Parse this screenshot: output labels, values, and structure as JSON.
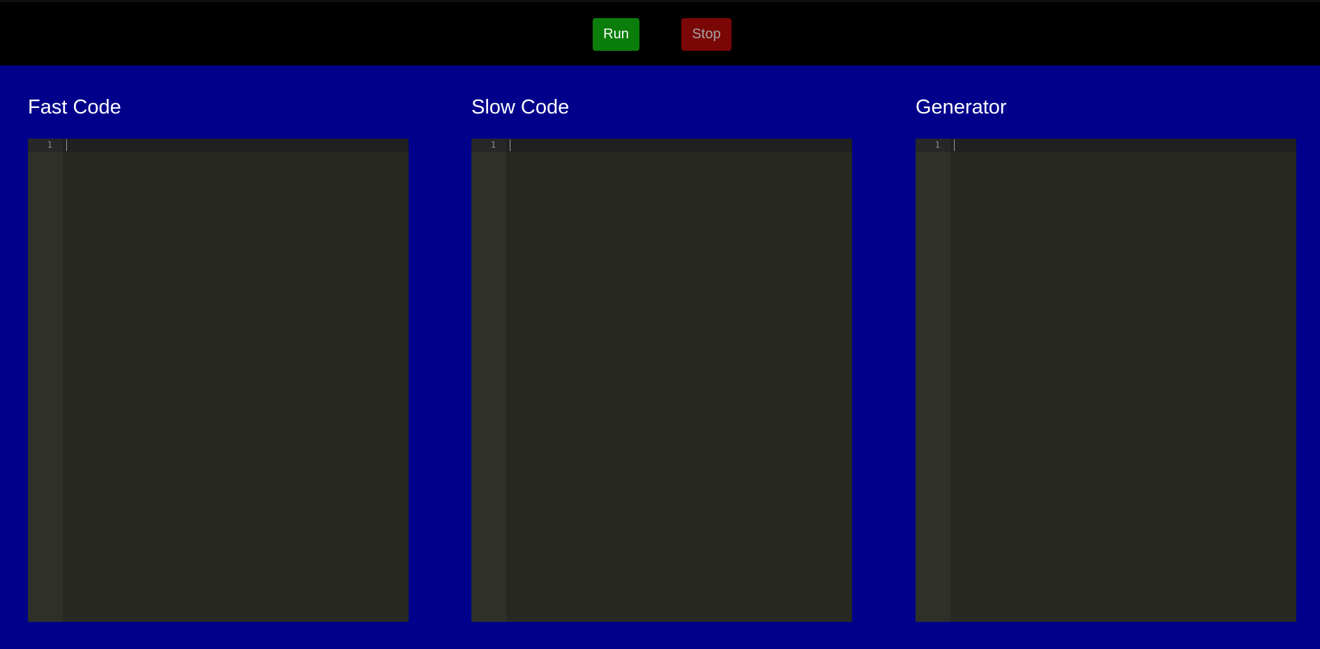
{
  "toolbar": {
    "run_label": "Run",
    "stop_label": "Stop"
  },
  "panels": [
    {
      "title": "Fast Code",
      "editor": {
        "line_numbers": [
          "1"
        ],
        "content": ""
      }
    },
    {
      "title": "Slow Code",
      "editor": {
        "line_numbers": [
          "1"
        ],
        "content": ""
      }
    },
    {
      "title": "Generator",
      "editor": {
        "line_numbers": [
          "1"
        ],
        "content": ""
      }
    }
  ],
  "colors": {
    "toolbar_bg": "#000000",
    "main_bg": "#00008b",
    "run_button": "#0a7d0a",
    "stop_button": "#7a0606",
    "editor_bg": "#272822",
    "gutter_bg": "#2f3129"
  }
}
